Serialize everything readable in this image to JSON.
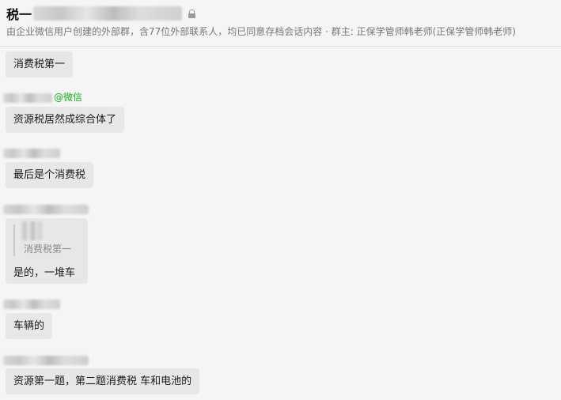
{
  "header": {
    "title": "税一",
    "subtitle": "由企业微信用户创建的外部群，含77位外部联系人，均已同意存档会话内容 · 群主: 正保学管师韩老师(正保学管师韩老师)"
  },
  "messages": [
    {
      "text": "消费税第一"
    },
    {
      "sender_tag": "@微信",
      "text": "资源税居然成综合体了"
    },
    {
      "text": "最后是个消费税"
    },
    {
      "quoted_text": "消费税第一",
      "text": "是的，一堆车"
    },
    {
      "text": "车辆的"
    },
    {
      "text": "资源第一题，第二题消费税 车和电池的"
    }
  ],
  "colors": {
    "background": "#f5f5f5",
    "bubble": "#e7e7e7",
    "wechat_green": "#1aad19",
    "subtitle_gray": "#777777"
  },
  "icons": {
    "lock": "lock-icon"
  }
}
